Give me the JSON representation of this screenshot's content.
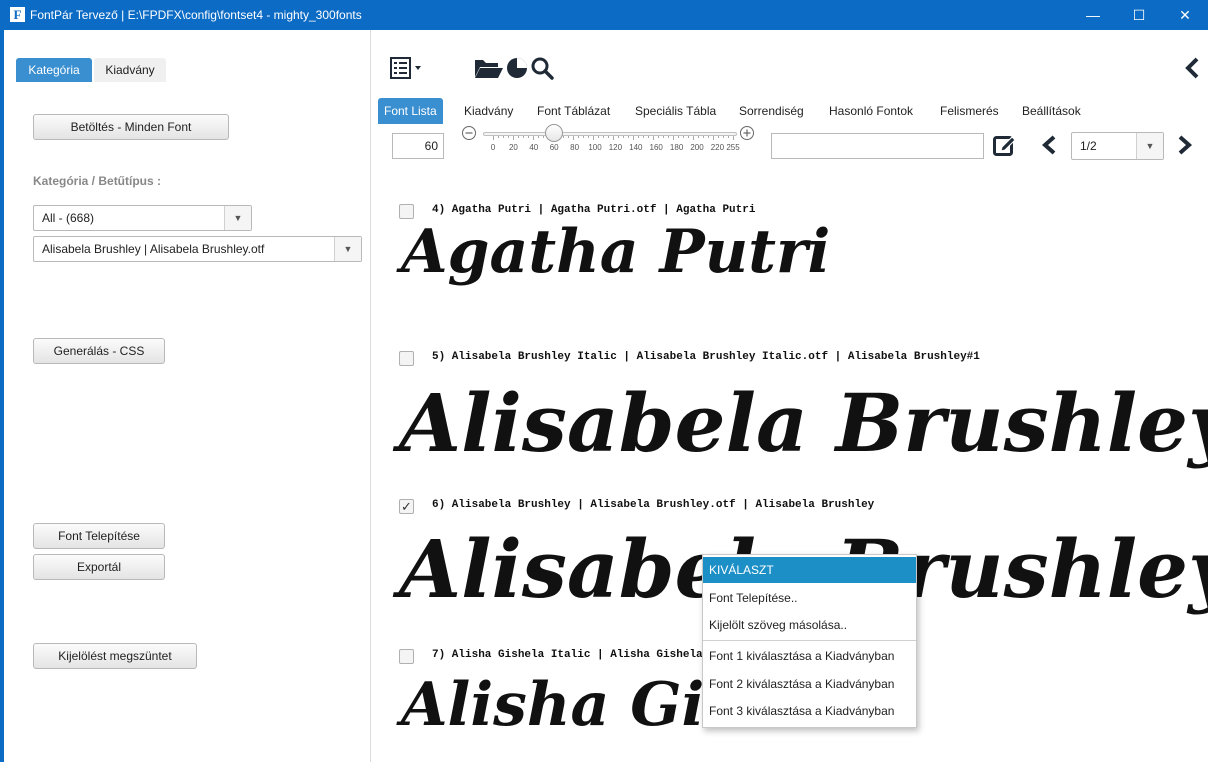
{
  "window": {
    "title": "FontPár Tervező | E:\\FPDFX\\config\\fontset4 - mighty_300fonts",
    "app_icon_letter": "F",
    "minimize": "—",
    "maximize": "☐",
    "close": "✕"
  },
  "left": {
    "tabs": [
      "Kategória",
      "Kiadvány"
    ],
    "load_all_button": "Betöltés - Minden Font",
    "category_label": "Kategória / Betűtípus :",
    "category_select": "All - (668)",
    "font_select": "Alisabela Brushley | Alisabela Brushley.otf",
    "generate_css_button": "Generálás - CSS",
    "install_font_button": "Font Telepítése",
    "export_button": "Exportál",
    "deselect_button": "Kijelölést megszüntet"
  },
  "main": {
    "tabs": [
      "Font Lista",
      "Kiadvány",
      "Font Táblázat",
      "Speciális Tábla",
      "Sorrendiség",
      "Hasonló Fontok",
      "Felismerés",
      "Beállítások"
    ],
    "active_tab": "Font Lista",
    "size_value": "60",
    "slider": {
      "value": 60,
      "min": 0,
      "max": 255,
      "tick_labels": [
        "0",
        "20",
        "40",
        "60",
        "80",
        "100",
        "120",
        "140",
        "160",
        "180",
        "200",
        "220",
        "255"
      ]
    },
    "text_input_value": "",
    "page_select": "1/2",
    "entries": [
      {
        "header": "4) Agatha Putri | Agatha Putri.otf | Agatha Putri",
        "sample": "Agatha Putri",
        "checked": false
      },
      {
        "header": "5) Alisabela Brushley Italic | Alisabela Brushley Italic.otf | Alisabela Brushley#1",
        "sample": "Alisabela Brushley",
        "checked": false
      },
      {
        "header": "6) Alisabela Brushley | Alisabela Brushley.otf | Alisabela Brushley",
        "sample": "Alisabela Brushley",
        "checked": true
      },
      {
        "header": "7) Alisha Gishela Italic | Alisha Gishela Italic.otf | Alisha Gishela#1",
        "sample": "Alisha Gishela",
        "checked": false
      }
    ]
  },
  "context_menu": {
    "items": [
      "KIVÁLASZT",
      "Font Telepítése..",
      "Kijelölt szöveg másolása..",
      "Font 1 kiválasztása a Kiadványban",
      "Font 2 kiválasztása a Kiadványban",
      "Font 3 kiválasztása a Kiadványban"
    ],
    "highlighted": "KIVÁLASZT"
  },
  "colors": {
    "titlebar": "#0c6bc4",
    "active_tab": "#3a8fd0",
    "menu_highlight": "#1c8fc6"
  }
}
